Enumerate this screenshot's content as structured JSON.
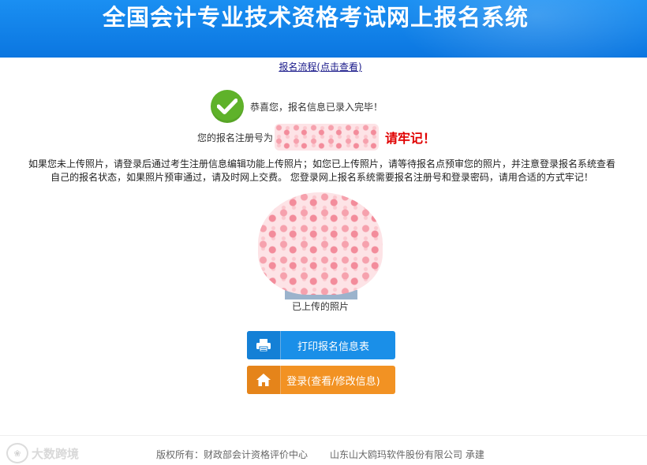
{
  "header": {
    "title": "全国会计专业技术资格考试网上报名系统"
  },
  "process_link": "报名流程(点击查看)",
  "success": {
    "message": "恭喜您，报名信息已录入完毕！"
  },
  "registration": {
    "label": "您的报名注册号为",
    "remember": "请牢记！"
  },
  "notice": {
    "line1": "如果您未上传照片，请登录后通过考生注册信息编辑功能上传照片；如您已上传照片，请等待报名点预审您的照片，并注意登录报名系统查看",
    "line2": "自己的报名状态，如果照片预审通过，请及时网上交费。 您登录网上报名系统需要报名注册号和登录密码，请用合适的方式牢记！"
  },
  "photo": {
    "caption": "已上传的照片"
  },
  "buttons": {
    "print": "打印报名信息表",
    "login": "登录(查看/修改信息)"
  },
  "footer": {
    "copyright": "版权所有：财政部会计资格评价中心",
    "vendor": "山东山大鸥玛软件股份有限公司 承建"
  },
  "watermark": {
    "text": "大数跨境"
  },
  "colors": {
    "header_blue": "#0b76e0",
    "success_green": "#5fb22a",
    "alert_red": "#e00000",
    "print_button": "#1a8fe8",
    "login_button": "#f29223"
  }
}
